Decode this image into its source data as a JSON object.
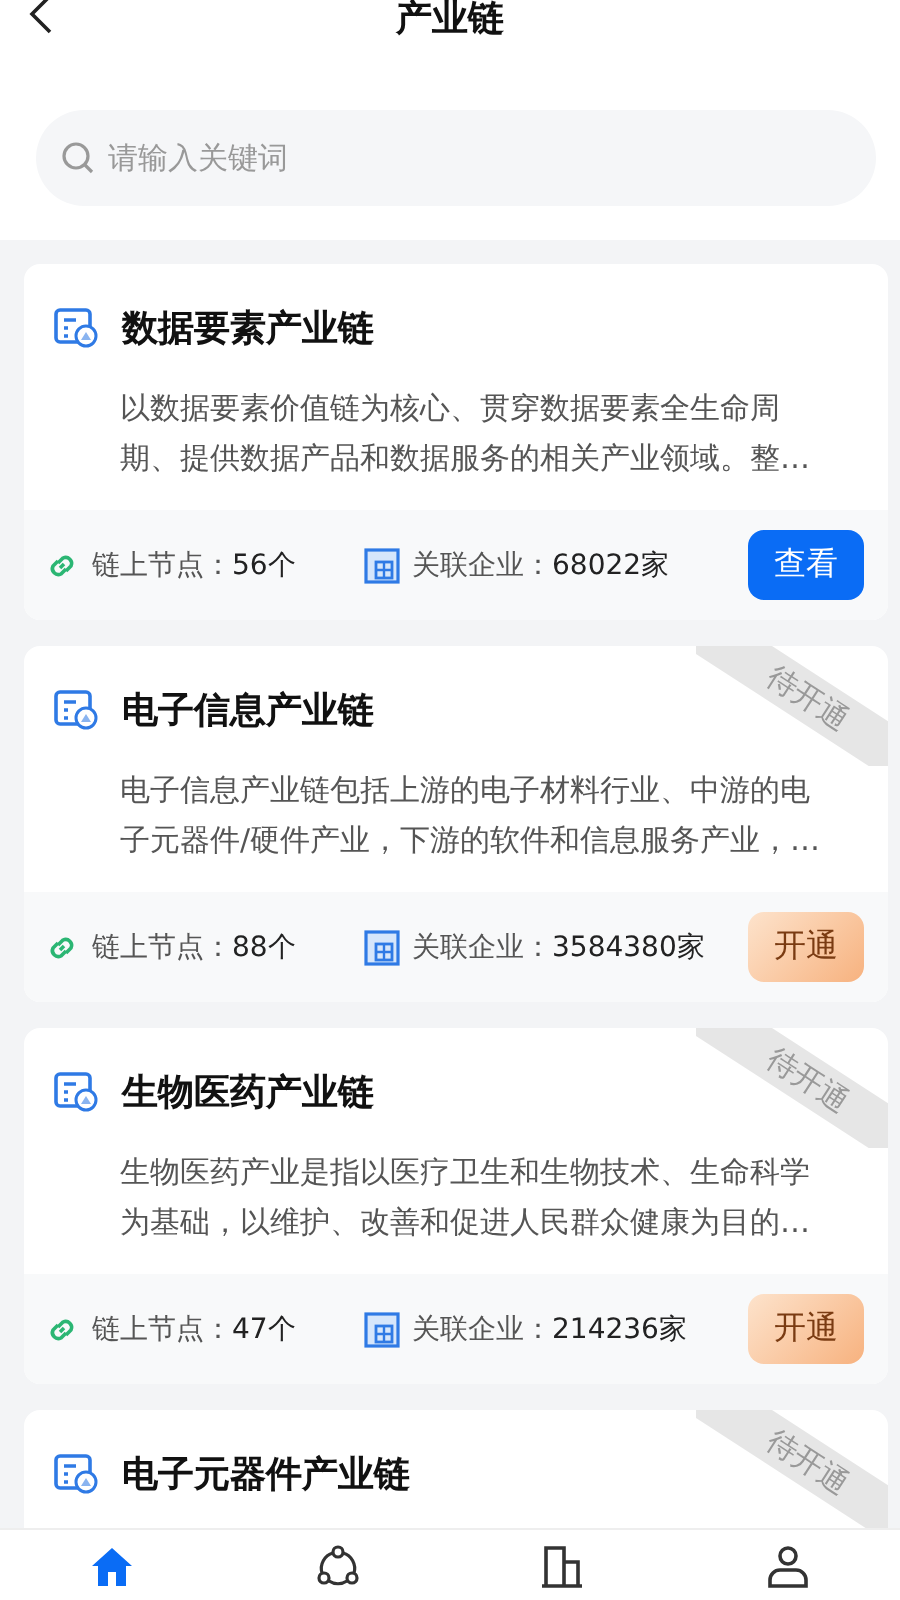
{
  "header": {
    "title": "产业链"
  },
  "search": {
    "placeholder": "请输入关键词"
  },
  "chains": [
    {
      "title": "数据要素产业链",
      "kind": "open",
      "description": "以数据要素价值链为核心、贯穿数据要素全生命周期、提供数据产品和数据服务的相关产业领域。整…",
      "nodes_label": "链上节点：",
      "nodes": "56个",
      "companies_label": "关联企业：",
      "companies": "68022家",
      "action": "查看"
    },
    {
      "title": "电子信息产业链",
      "kind": "locked",
      "ribbon": "待开通",
      "description": "电子信息产业链包括上游的电子材料行业、中游的电子元器件/硬件产业，下游的软件和信息服务产业，…",
      "nodes_label": "链上节点：",
      "nodes": "88个",
      "companies_label": "关联企业：",
      "companies": "3584380家",
      "action": "开通"
    },
    {
      "title": "生物医药产业链",
      "kind": "locked",
      "ribbon": "待开通",
      "description": "生物医药产业是指以医疗卫生和生物技术、生命科学为基础，以维护、改善和促进人民群众健康为目的…",
      "nodes_label": "链上节点：",
      "nodes": "47个",
      "companies_label": "关联企业：",
      "companies": "214236家",
      "action": "开通"
    },
    {
      "title": "电子元器件产业链",
      "kind": "locked",
      "ribbon": "待开通"
    }
  ],
  "tabs": [
    {
      "selected": true
    },
    {
      "selected": false
    },
    {
      "selected": false
    },
    {
      "selected": false
    }
  ]
}
